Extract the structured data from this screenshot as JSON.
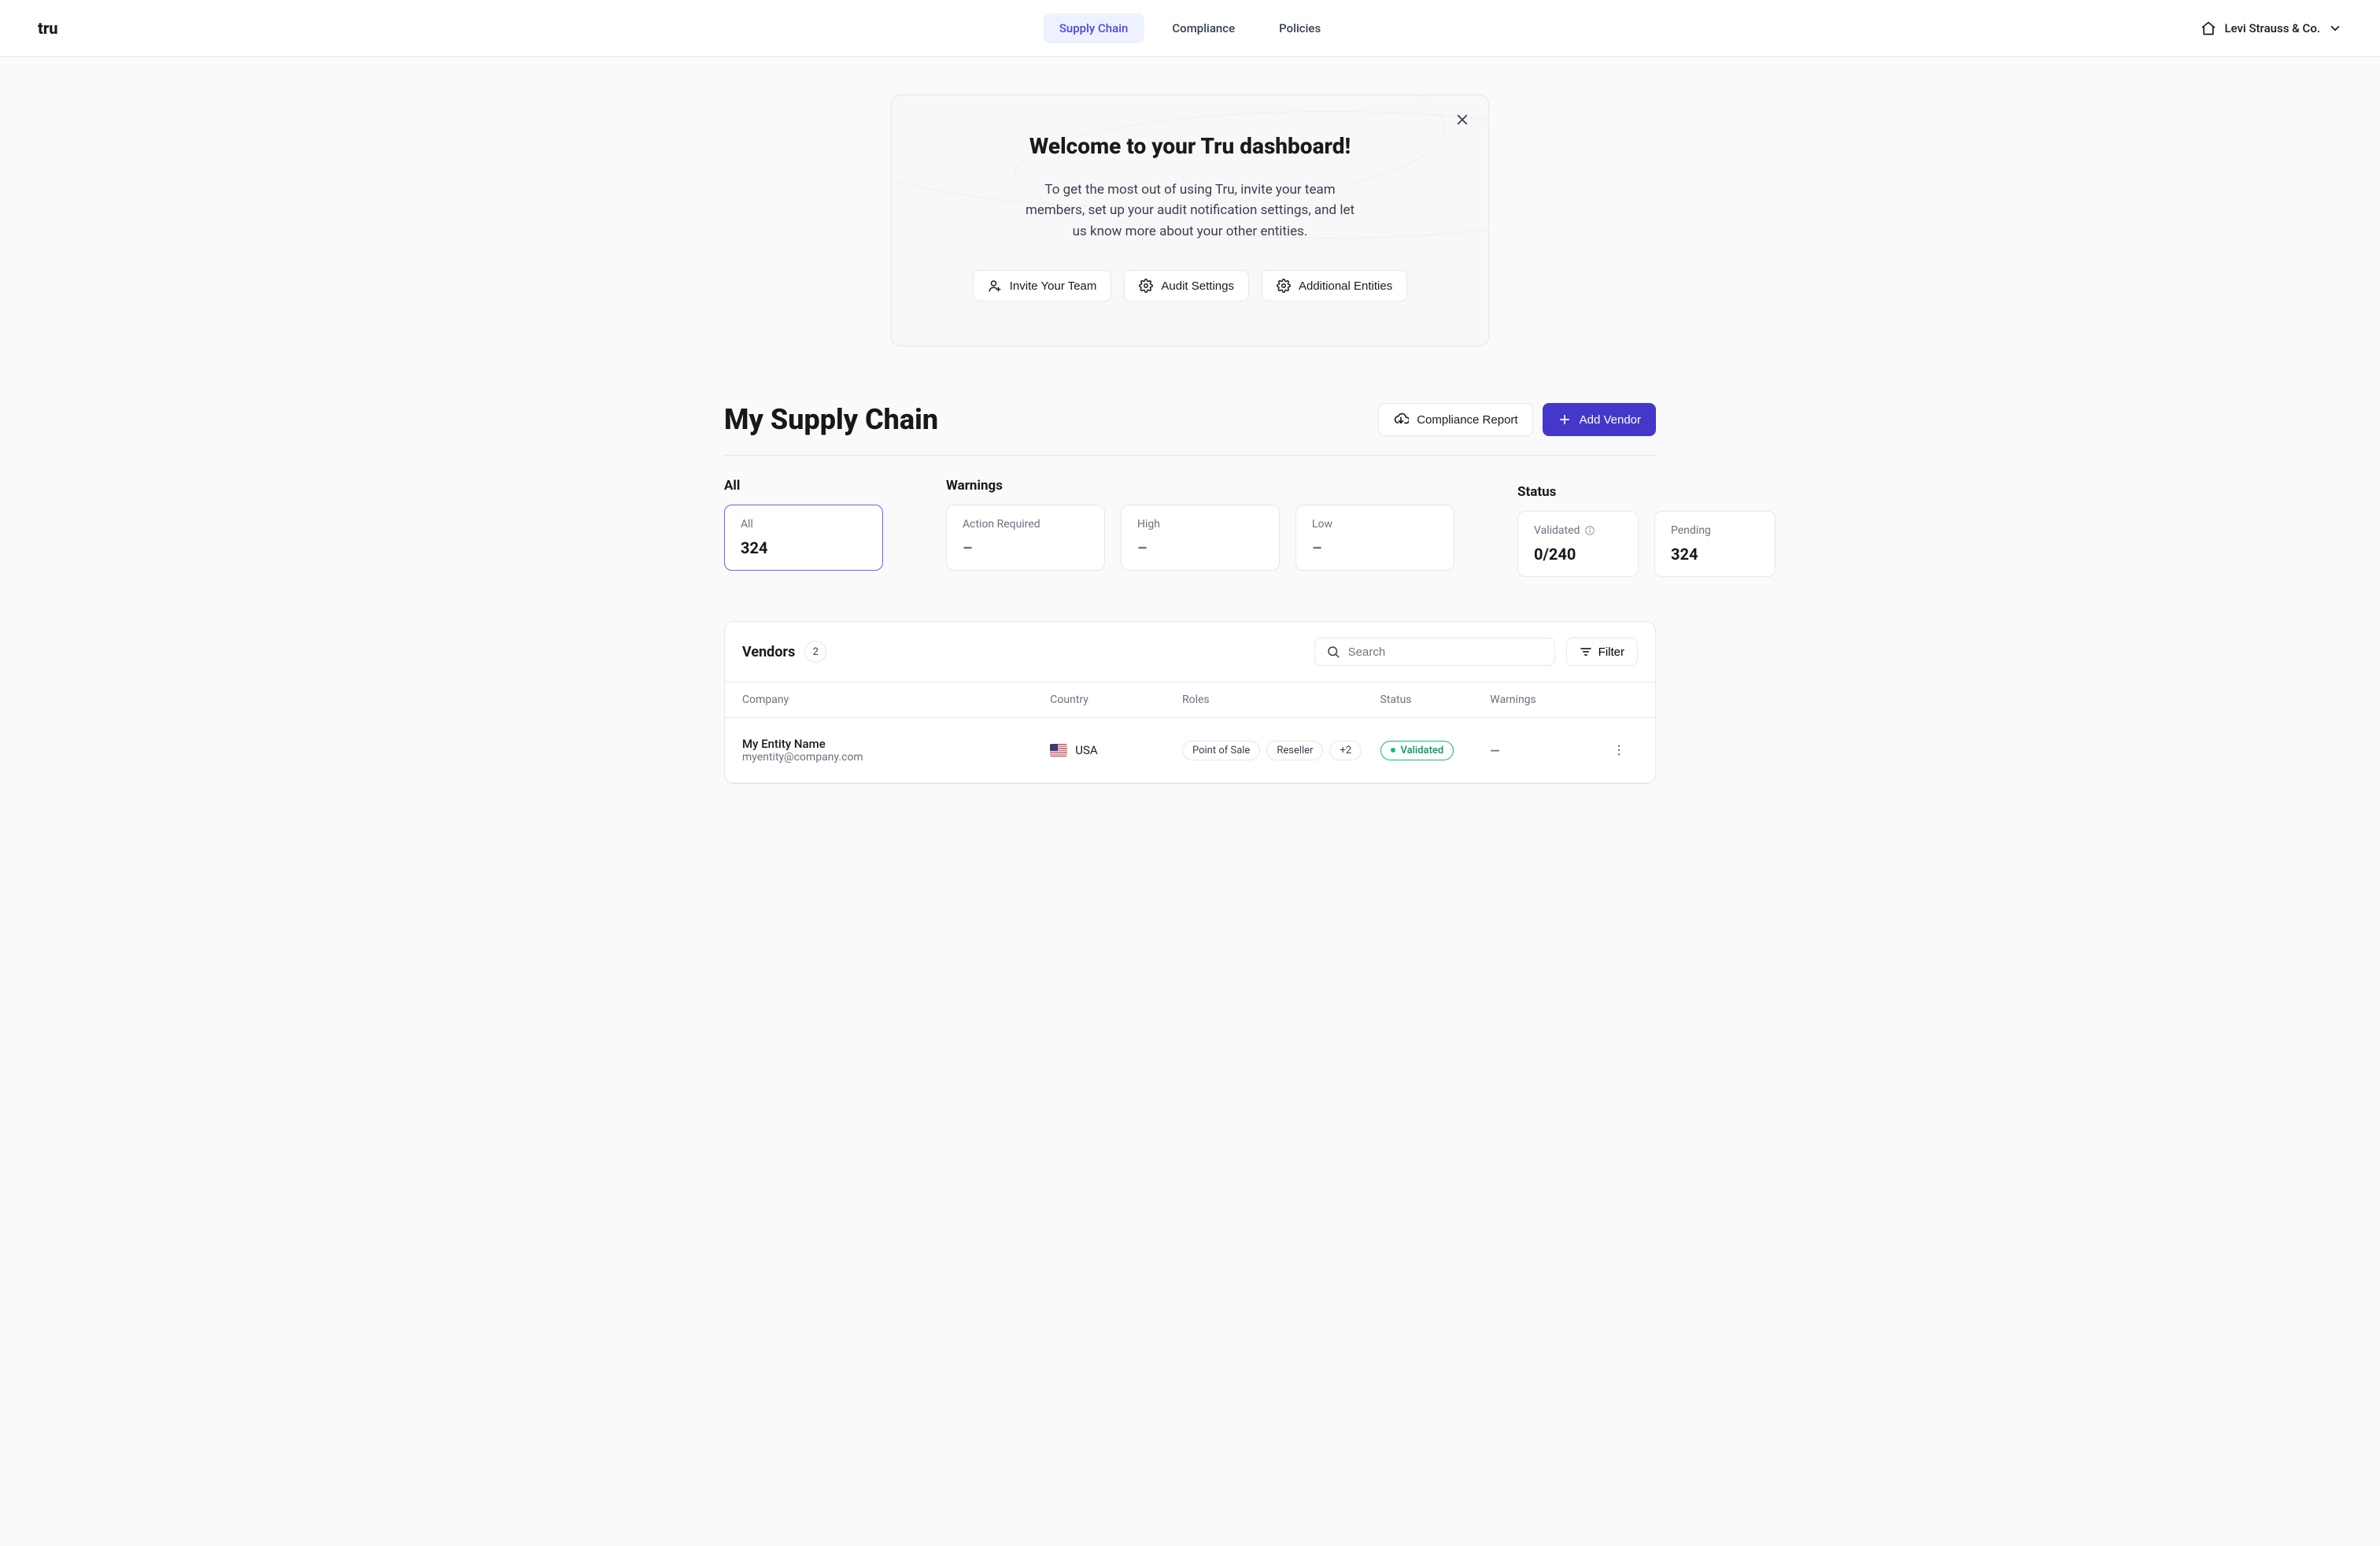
{
  "header": {
    "logo": "tru",
    "nav": [
      {
        "label": "Supply Chain",
        "active": true
      },
      {
        "label": "Compliance",
        "active": false
      },
      {
        "label": "Policies",
        "active": false
      }
    ],
    "company": "Levi Strauss & Co."
  },
  "welcome": {
    "title": "Welcome to your Tru dashboard!",
    "body": "To get the most out of using Tru, invite your team members, set up your audit notification settings, and let us know more about your other entities.",
    "buttons": {
      "invite": "Invite Your Team",
      "audit": "Audit Settings",
      "entities": "Additional Entities"
    }
  },
  "page": {
    "title": "My Supply Chain",
    "actions": {
      "compliance_report": "Compliance Report",
      "add_vendor": "Add Vendor"
    }
  },
  "stats": {
    "all": {
      "group_label": "All",
      "card_label": "All",
      "value": "324"
    },
    "warnings": {
      "group_label": "Warnings",
      "action_required": {
        "label": "Action Required",
        "value": "–"
      },
      "high": {
        "label": "High",
        "value": "–"
      },
      "low": {
        "label": "Low",
        "value": "–"
      }
    },
    "status": {
      "group_label": "Status",
      "validated": {
        "label": "Validated",
        "value": "0/240"
      },
      "pending": {
        "label": "Pending",
        "value": "324"
      }
    }
  },
  "vendors": {
    "title": "Vendors",
    "count": "2",
    "search_placeholder": "Search",
    "filter_label": "Filter",
    "columns": {
      "company": "Company",
      "country": "Country",
      "roles": "Roles",
      "status": "Status",
      "warnings": "Warnings"
    },
    "rows": [
      {
        "name": "My Entity Name",
        "email": "myentity@company.com",
        "country": "USA",
        "roles": [
          "Point of Sale",
          "Reseller"
        ],
        "extra_roles": "+2",
        "status": "Validated",
        "warnings": "—"
      }
    ]
  }
}
